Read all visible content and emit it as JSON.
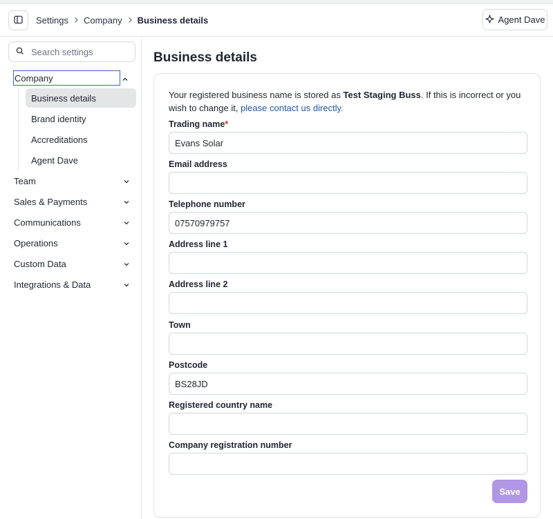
{
  "header": {
    "breadcrumb": [
      "Settings",
      "Company",
      "Business details"
    ],
    "agent_button_label": "Agent Dave"
  },
  "sidebar": {
    "search_placeholder": "Search settings",
    "company_label": "Company",
    "company_subitems": [
      "Business details",
      "Brand identity",
      "Accreditations",
      "Agent Dave"
    ],
    "active_subitem": "Business details",
    "sections": [
      "Team",
      "Sales & Payments",
      "Communications",
      "Operations",
      "Custom Data",
      "Integrations & Data"
    ]
  },
  "main": {
    "title": "Business details",
    "intro_prefix": "Your registered business name is stored as ",
    "intro_business_name": "Test Staging Buss",
    "intro_middle": ". If this is incorrect or you wish to change it, ",
    "intro_link": "please contact us directly.",
    "fields": [
      {
        "label": "Trading name",
        "required": "*",
        "value": ""
      },
      {
        "label": "Email address",
        "value": ""
      },
      {
        "label": "Telephone number",
        "value": ""
      },
      {
        "label": "Address line 1",
        "value": ""
      },
      {
        "label": "Address line 2",
        "value": ""
      },
      {
        "label": "Town",
        "value": ""
      },
      {
        "label": "Postcode",
        "value": ""
      },
      {
        "label": "Registered country name",
        "value": ""
      },
      {
        "label": "Company registration number",
        "value": ""
      }
    ],
    "trading_name_value": "Evans Solar",
    "telephone_value": "07570979757",
    "postcode_value": "BS28JD",
    "save_label": "Save"
  },
  "colors": {
    "accent_save": "#b196e6",
    "link": "#2256a8",
    "focus_outline": "#3b63b8",
    "required": "#d0342c"
  },
  "icons": {
    "toggle": "sidebar-panel-icon",
    "agent": "sparkle-icon",
    "search": "search-icon",
    "breadcrumb_separator": "chevron-right-icon",
    "expand": "chevron-down-icon",
    "collapse": "chevron-up-icon"
  }
}
